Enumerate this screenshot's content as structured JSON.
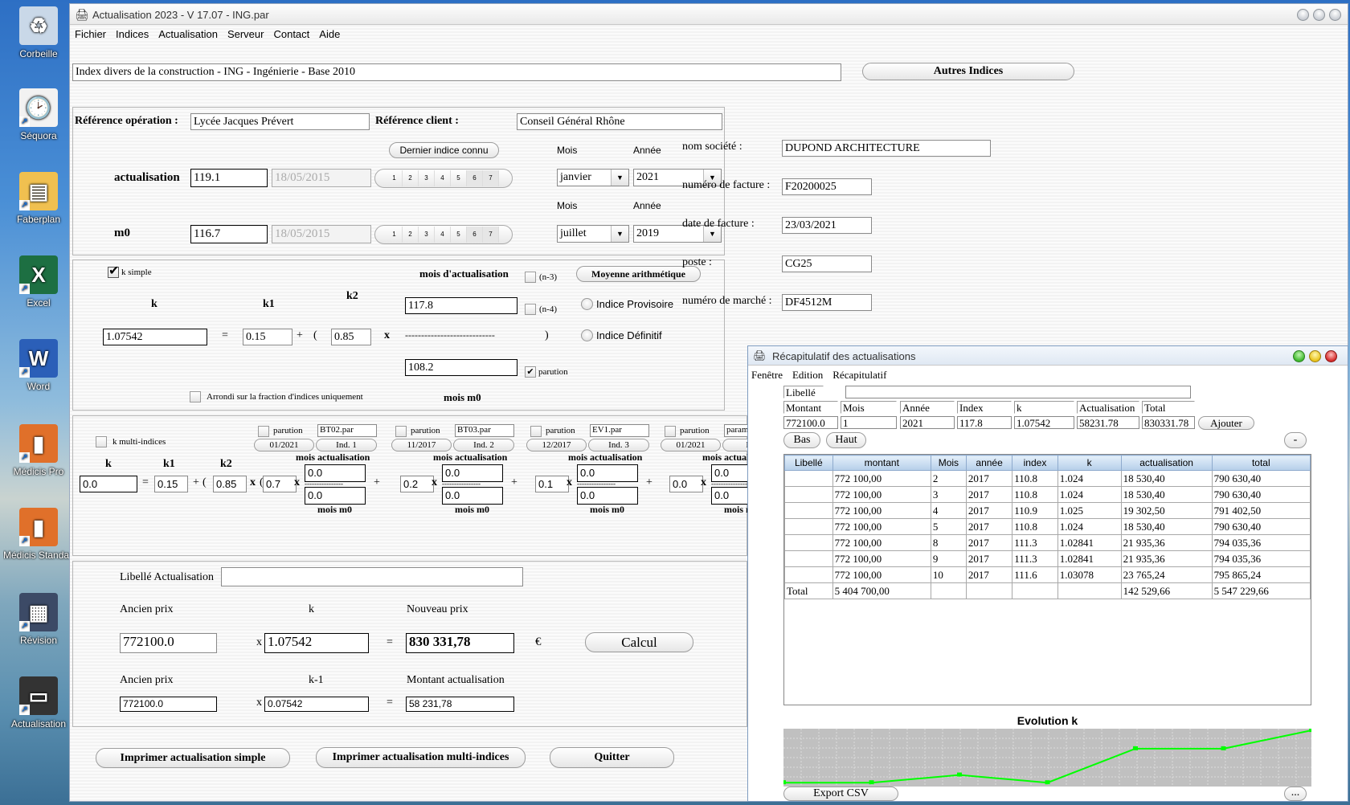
{
  "desktop": {
    "icons": [
      {
        "label": "Corbeille",
        "icon": "recycle-bin-icon"
      },
      {
        "label": "Séquora",
        "icon": "document-clock-icon"
      },
      {
        "label": "Faberplan",
        "icon": "gantt-chart-icon"
      },
      {
        "label": "Excel",
        "icon": "excel-icon"
      },
      {
        "label": "Word",
        "icon": "word-icon"
      },
      {
        "label": "Médicis Pro",
        "icon": "bar-chart-icon"
      },
      {
        "label": "Médicis Standard",
        "icon": "bar-chart-icon"
      },
      {
        "label": "Révision",
        "icon": "calculator-icon"
      },
      {
        "label": "Actualisation",
        "icon": "payment-terminal-icon"
      }
    ]
  },
  "window": {
    "title": "Actualisation 2023 - V 17.07 - ING.par",
    "menu": [
      "Fichier",
      "Indices",
      "Actualisation",
      "Serveur",
      "Contact",
      "Aide"
    ]
  },
  "index_title": "Index divers de la construction - ING - Ingénierie - Base 2010",
  "autres_indices": "Autres Indices",
  "refs": {
    "op_label": "Référence opération :",
    "op_value": "Lycée Jacques Prévert",
    "client_label": "Référence client :",
    "client_value": "Conseil Général Rhône"
  },
  "dernier_indice": "Dernier indice connu",
  "mois_label": "Mois",
  "annee_label": "Année",
  "actualisation": {
    "label": "actualisation",
    "value": "119.1",
    "date": "18/05/2015",
    "mois": "janvier",
    "annee": "2021"
  },
  "m0": {
    "label": "m0",
    "value": "116.7",
    "date": "18/05/2015",
    "mois": "juillet",
    "annee": "2019"
  },
  "days": [
    "1",
    "2",
    "3",
    "4",
    "5",
    "6",
    "7"
  ],
  "ksimple": {
    "checkbox_label": "k simple",
    "checked": true,
    "k_label": "k",
    "k1_label": "k1",
    "k2_label": "k2",
    "k": "1.07542",
    "k1": "0.15",
    "k2": "0.85",
    "mois_act_label": "mois d'actualisation",
    "mois_act": "117.8",
    "mois_m0": "108.2",
    "mois_m0_label": "mois m0",
    "n3": "(n-3)",
    "n4": "(n-4)",
    "parution": "parution",
    "moyenne": "Moyenne arithmétique",
    "provisoire": "Indice Provisoire",
    "definitif": "Indice Définitif",
    "arrondi": "Arrondi sur la fraction d'indices uniquement",
    "dashes": "----------------------------",
    "eq": "=",
    "plus": "+",
    "lpar": "(",
    "rpar": ")",
    "x": "x"
  },
  "multi": {
    "checkbox_label": "k multi-indices",
    "k": "0.0",
    "k1": "0.15",
    "k2": "0.85",
    "indices": [
      {
        "parution": "parution",
        "file": "BT02.par",
        "date": "01/2021",
        "ind": "Ind. 1",
        "coef": "0.7",
        "act": "0.0",
        "m0": "0.0"
      },
      {
        "parution": "parution",
        "file": "BT03.par",
        "date": "11/2017",
        "ind": "Ind. 2",
        "coef": "0.2",
        "act": "0.0",
        "m0": "0.0"
      },
      {
        "parution": "parution",
        "file": "EV1.par",
        "date": "12/2017",
        "ind": "Ind. 3",
        "coef": "0.1",
        "act": "0.0",
        "m0": "0.0"
      },
      {
        "parution": "parution",
        "file": "paramG",
        "date": "01/2021",
        "ind": "Ind.",
        "coef": "0.0",
        "act": "0.0",
        "m0": "0.0"
      }
    ],
    "mois_act_label": "mois actualisation",
    "mois_m0_label": "mois m0",
    "dashes": "----------------"
  },
  "calc": {
    "libelle_label": "Libellé Actualisation",
    "libelle_value": "",
    "ancien_prix_label": "Ancien prix",
    "k_label": "k",
    "nouveau_prix_label": "Nouveau prix",
    "ancien_prix": "772100.0",
    "k": "1.07542",
    "nouveau_prix": "830 331,78",
    "currency": "€",
    "calcul": "Calcul",
    "km1_label": "k-1",
    "montant_label": "Montant actualisation",
    "ancien_prix2": "772100.0",
    "km1": "0.07542",
    "montant": "58 231,78"
  },
  "buttons": {
    "print_simple": "Imprimer actualisation simple",
    "print_multi": "Imprimer actualisation multi-indices",
    "quit": "Quitter"
  },
  "invoice": {
    "societe_label": "nom société :",
    "societe": "DUPOND ARCHITECTURE",
    "facture_label": "numéro de facture :",
    "facture": "F20200025",
    "date_label": "date de facture :",
    "date": "23/03/2021",
    "poste_label": "poste :",
    "poste": "CG25",
    "marche_label": "numéro de marché :",
    "marche": "DF4512M"
  },
  "recap": {
    "title": "Récapitulatif des actualisations",
    "menu": [
      "Fenêtre",
      "Edition",
      "Récapitulatif"
    ],
    "libelle_label": "Libellé",
    "libelle_value": "",
    "entry_headers": [
      "Montant",
      "Mois",
      "Année",
      "Index",
      "k",
      "Actualisation",
      "Total"
    ],
    "entry_values": [
      "772100.0",
      "1",
      "2021",
      "117.8",
      "1.07542",
      "58231.78",
      "830331.78"
    ],
    "ajouter": "Ajouter",
    "bas": "Bas",
    "haut": "Haut",
    "minus": "-",
    "export": "Export CSV",
    "more": "...",
    "columns": [
      "Libellé",
      "montant",
      "Mois",
      "année",
      "index",
      "k",
      "actualisation",
      "total"
    ],
    "rows": [
      [
        "",
        "772 100,00",
        "2",
        "2017",
        "110.8",
        "1.024",
        "18 530,40",
        "790 630,40"
      ],
      [
        "",
        "772 100,00",
        "3",
        "2017",
        "110.8",
        "1.024",
        "18 530,40",
        "790 630,40"
      ],
      [
        "",
        "772 100,00",
        "4",
        "2017",
        "110.9",
        "1.025",
        "19 302,50",
        "791 402,50"
      ],
      [
        "",
        "772 100,00",
        "5",
        "2017",
        "110.8",
        "1.024",
        "18 530,40",
        "790 630,40"
      ],
      [
        "",
        "772 100,00",
        "8",
        "2017",
        "111.3",
        "1.02841",
        "21 935,36",
        "794 035,36"
      ],
      [
        "",
        "772 100,00",
        "9",
        "2017",
        "111.3",
        "1.02841",
        "21 935,36",
        "794 035,36"
      ],
      [
        "",
        "772 100,00",
        "10",
        "2017",
        "111.6",
        "1.03078",
        "23 765,24",
        "795 865,24"
      ]
    ],
    "total_row": [
      "Total",
      "5 404 700,00",
      "",
      "",
      "",
      "",
      "142 529,66",
      "5 547 229,66"
    ]
  },
  "chart_data": {
    "type": "line",
    "title": "Evolution k",
    "x": [
      2,
      3,
      4,
      5,
      8,
      9,
      10
    ],
    "series": [
      {
        "name": "k",
        "values": [
          1.024,
          1.024,
          1.025,
          1.024,
          1.02841,
          1.02841,
          1.03078
        ],
        "color": "#00ff00"
      }
    ],
    "ylim": [
      1.0235,
      1.031
    ],
    "grid": true
  }
}
